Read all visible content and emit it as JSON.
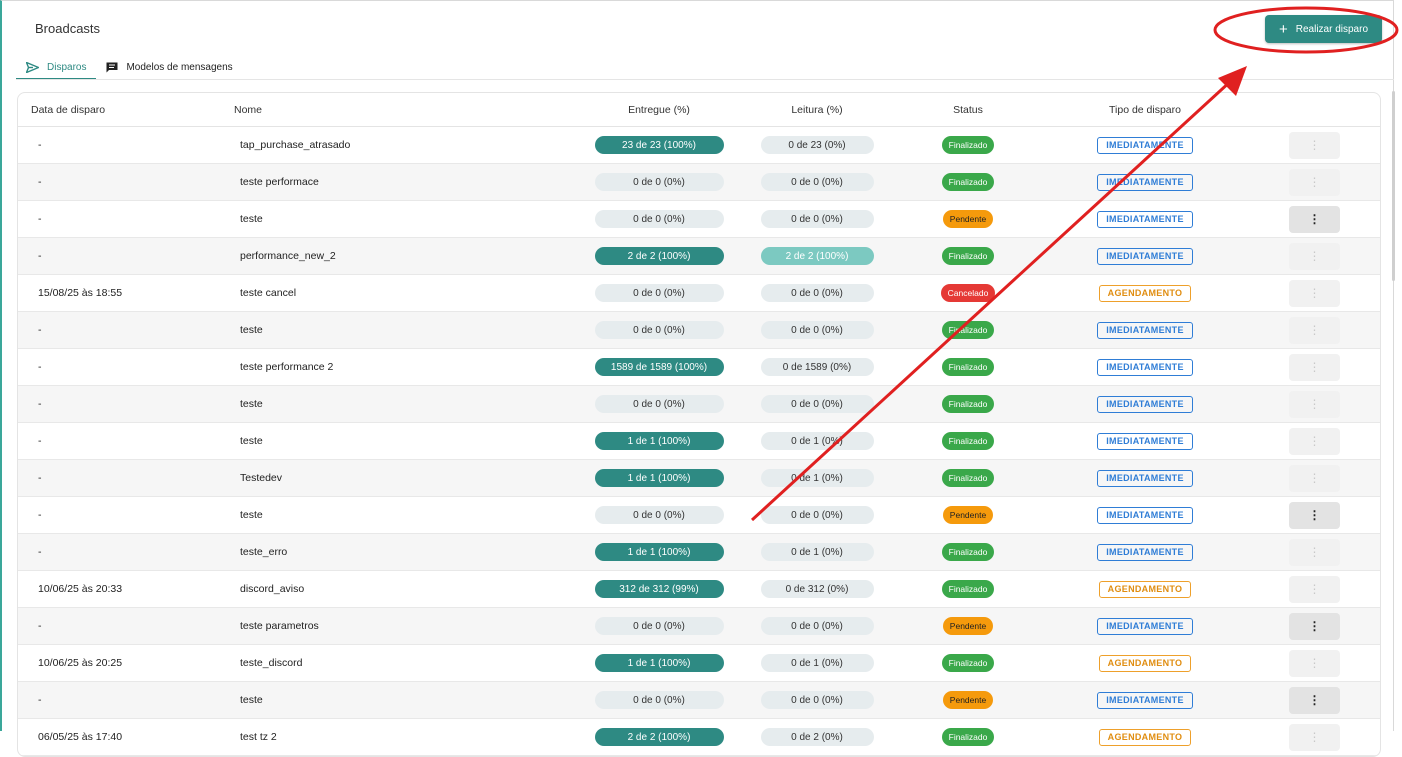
{
  "header": {
    "title": "Broadcasts",
    "primary_button": "Realizar disparo"
  },
  "tabs": [
    {
      "label": "Disparos",
      "active": true,
      "icon": "send-icon"
    },
    {
      "label": "Modelos de mensagens",
      "active": false,
      "icon": "message-icon"
    }
  ],
  "table": {
    "headers": {
      "date": "Data de disparo",
      "name": "Nome",
      "entregue": "Entregue (%)",
      "leitura": "Leitura (%)",
      "status": "Status",
      "tipo": "Tipo de disparo"
    },
    "rows": [
      {
        "date": "-",
        "name": "tap_purchase_atrasado",
        "entregue": "23 de 23 (100%)",
        "leitura": "0 de 23 (0%)",
        "status": "Finalizado",
        "tipo": "IMEDIATAMENTE"
      },
      {
        "date": "-",
        "name": "teste performace",
        "entregue": "0 de 0 (0%)",
        "leitura": "0 de 0 (0%)",
        "status": "Finalizado",
        "tipo": "IMEDIATAMENTE"
      },
      {
        "date": "-",
        "name": "teste",
        "entregue": "0 de 0 (0%)",
        "leitura": "0 de 0 (0%)",
        "status": "Pendente",
        "tipo": "IMEDIATAMENTE"
      },
      {
        "date": "-",
        "name": "performance_new_2",
        "entregue": "2 de 2 (100%)",
        "leitura": "2 de 2 (100%)",
        "status": "Finalizado",
        "tipo": "IMEDIATAMENTE"
      },
      {
        "date": "15/08/25 às 18:55",
        "name": "teste cancel",
        "entregue": "0 de 0 (0%)",
        "leitura": "0 de 0 (0%)",
        "status": "Cancelado",
        "tipo": "AGENDAMENTO"
      },
      {
        "date": "-",
        "name": "teste",
        "entregue": "0 de 0 (0%)",
        "leitura": "0 de 0 (0%)",
        "status": "Finalizado",
        "tipo": "IMEDIATAMENTE"
      },
      {
        "date": "-",
        "name": "teste performance 2",
        "entregue": "1589 de 1589 (100%)",
        "leitura": "0 de 1589 (0%)",
        "status": "Finalizado",
        "tipo": "IMEDIATAMENTE"
      },
      {
        "date": "-",
        "name": "teste",
        "entregue": "0 de 0 (0%)",
        "leitura": "0 de 0 (0%)",
        "status": "Finalizado",
        "tipo": "IMEDIATAMENTE"
      },
      {
        "date": "-",
        "name": "teste",
        "entregue": "1 de 1 (100%)",
        "leitura": "0 de 1 (0%)",
        "status": "Finalizado",
        "tipo": "IMEDIATAMENTE"
      },
      {
        "date": "-",
        "name": "Testedev",
        "entregue": "1 de 1 (100%)",
        "leitura": "0 de 1 (0%)",
        "status": "Finalizado",
        "tipo": "IMEDIATAMENTE"
      },
      {
        "date": "-",
        "name": "teste",
        "entregue": "0 de 0 (0%)",
        "leitura": "0 de 0 (0%)",
        "status": "Pendente",
        "tipo": "IMEDIATAMENTE"
      },
      {
        "date": "-",
        "name": "teste_erro",
        "entregue": "1 de 1 (100%)",
        "leitura": "0 de 1 (0%)",
        "status": "Finalizado",
        "tipo": "IMEDIATAMENTE"
      },
      {
        "date": "10/06/25 às 20:33",
        "name": "discord_aviso",
        "entregue": "312 de 312 (99%)",
        "leitura": "0 de 312 (0%)",
        "status": "Finalizado",
        "tipo": "AGENDAMENTO"
      },
      {
        "date": "-",
        "name": "teste parametros",
        "entregue": "0 de 0 (0%)",
        "leitura": "0 de 0 (0%)",
        "status": "Pendente",
        "tipo": "IMEDIATAMENTE"
      },
      {
        "date": "10/06/25 às 20:25",
        "name": "teste_discord",
        "entregue": "1 de 1 (100%)",
        "leitura": "0 de 1 (0%)",
        "status": "Finalizado",
        "tipo": "AGENDAMENTO"
      },
      {
        "date": "-",
        "name": "teste",
        "entregue": "0 de 0 (0%)",
        "leitura": "0 de 0 (0%)",
        "status": "Pendente",
        "tipo": "IMEDIATAMENTE"
      },
      {
        "date": "06/05/25 às 17:40",
        "name": "test tz 2",
        "entregue": "2 de 2 (100%)",
        "leitura": "0 de 2 (0%)",
        "status": "Finalizado",
        "tipo": "AGENDAMENTO"
      }
    ],
    "row_action_icon": "more-vertical-icon"
  },
  "colors": {
    "accent": "#2e8a83",
    "status_finalizado": "#3aa84a",
    "status_pendente": "#f59a0c",
    "status_cancelado": "#e53935",
    "type_imediatamente": "#2f7dd6",
    "type_agendamento": "#e08d10",
    "annotation": "#e02020"
  }
}
